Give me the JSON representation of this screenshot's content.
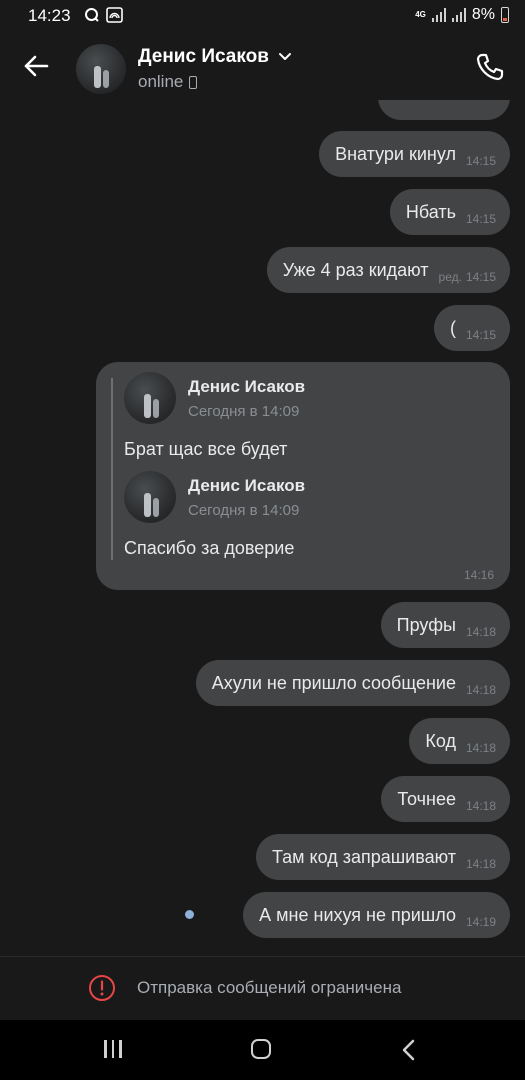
{
  "status_bar": {
    "time": "14:23",
    "network": "4G",
    "battery": "8%"
  },
  "header": {
    "contact_name": "Денис Исаков",
    "status": "online"
  },
  "messages": [
    {
      "text": "Внатури  кинул",
      "time": "14:15"
    },
    {
      "text": "Нбать",
      "time": "14:15"
    },
    {
      "text": "Уже 4 раз кидают",
      "edited": "ред.",
      "time": "14:15"
    },
    {
      "text": "(",
      "time": "14:15"
    }
  ],
  "forwarded": {
    "time": "14:16",
    "items": [
      {
        "author": "Денис Исаков",
        "date": "Сегодня в 14:09",
        "text": "Брат щас все будет"
      },
      {
        "author": "Денис Исаков",
        "date": "Сегодня в 14:09",
        "text": "Спасибо за доверие"
      }
    ]
  },
  "messages_after": [
    {
      "text": "Пруфы",
      "time": "14:18"
    },
    {
      "text": "Ахули не пришло сообщение",
      "time": "14:18"
    },
    {
      "text": "Код",
      "time": "14:18"
    },
    {
      "text": "Точнее",
      "time": "14:18"
    },
    {
      "text": "Там код запрашивают",
      "time": "14:18"
    },
    {
      "text": "А мне нихуя не пришло",
      "time": "14:19"
    }
  ],
  "restriction": {
    "text": "Отправка сообщений ограничена"
  },
  "colors": {
    "background": "#19191a",
    "bubble": "#434445",
    "unread_dot": "#8fb0d8",
    "warning": "#e64646"
  }
}
